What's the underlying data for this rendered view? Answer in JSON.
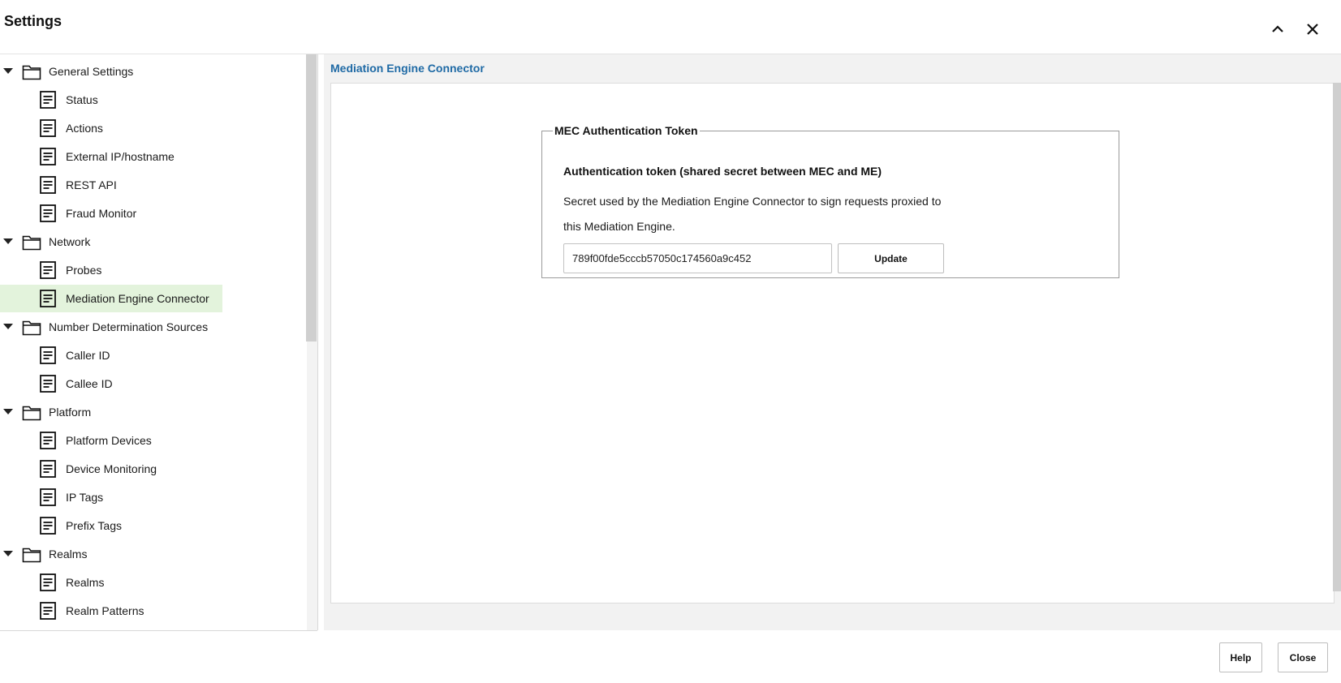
{
  "window": {
    "title": "Settings",
    "collapse_icon": "chevron-up-icon",
    "close_icon": "close-icon"
  },
  "tree": {
    "groups": [
      {
        "label": "General Settings",
        "items": [
          "Status",
          "Actions",
          "External IP/hostname",
          "REST API",
          "Fraud Monitor"
        ]
      },
      {
        "label": "Network",
        "items": [
          "Probes",
          "Mediation Engine Connector"
        ]
      },
      {
        "label": "Number Determination Sources",
        "items": [
          "Caller ID",
          "Callee ID"
        ]
      },
      {
        "label": "Platform",
        "items": [
          "Platform Devices",
          "Device Monitoring",
          "IP Tags",
          "Prefix Tags"
        ]
      },
      {
        "label": "Realms",
        "items": [
          "Realms",
          "Realm Patterns"
        ]
      }
    ],
    "selected": "Mediation Engine Connector"
  },
  "content": {
    "title": "Mediation Engine Connector",
    "section": {
      "legend": "MEC Authentication Token",
      "heading": "Authentication token (shared secret between MEC and ME)",
      "description": "Secret used by the Mediation Engine Connector to sign requests proxied to this Mediation Engine.",
      "token_value": "789f00fde5cccb57050c174560a9c452",
      "update_label": "Update"
    }
  },
  "footer": {
    "help_label": "Help",
    "close_label": "Close"
  },
  "colors": {
    "accent": "#1f6aa5",
    "selected_bg": "#e3f3dc"
  }
}
